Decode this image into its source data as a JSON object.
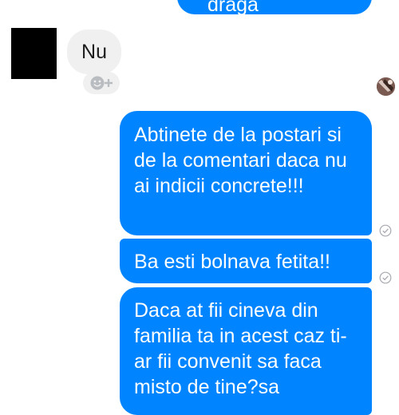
{
  "conversation": {
    "top_message_fragment": "draga",
    "incoming_message": "Nu",
    "outgoing": [
      {
        "text": "Abtinete de la postari si de la comentari daca nu ai indicii concrete!!!"
      },
      {
        "text": "Ba esti bolnava fetita!!"
      },
      {
        "text": "Daca at fii cineva din familia ta in acest caz ti-ar fii convenit sa faca misto de tine?sa"
      }
    ]
  },
  "icons": {
    "reaction": "add-reaction-icon",
    "read_receipt": "check-circle-icon"
  },
  "colors": {
    "outgoing_bubble": "#0084ff",
    "incoming_bubble": "#f1f0f0",
    "outgoing_text": "#ffffff",
    "incoming_text": "#1d1d1d"
  }
}
